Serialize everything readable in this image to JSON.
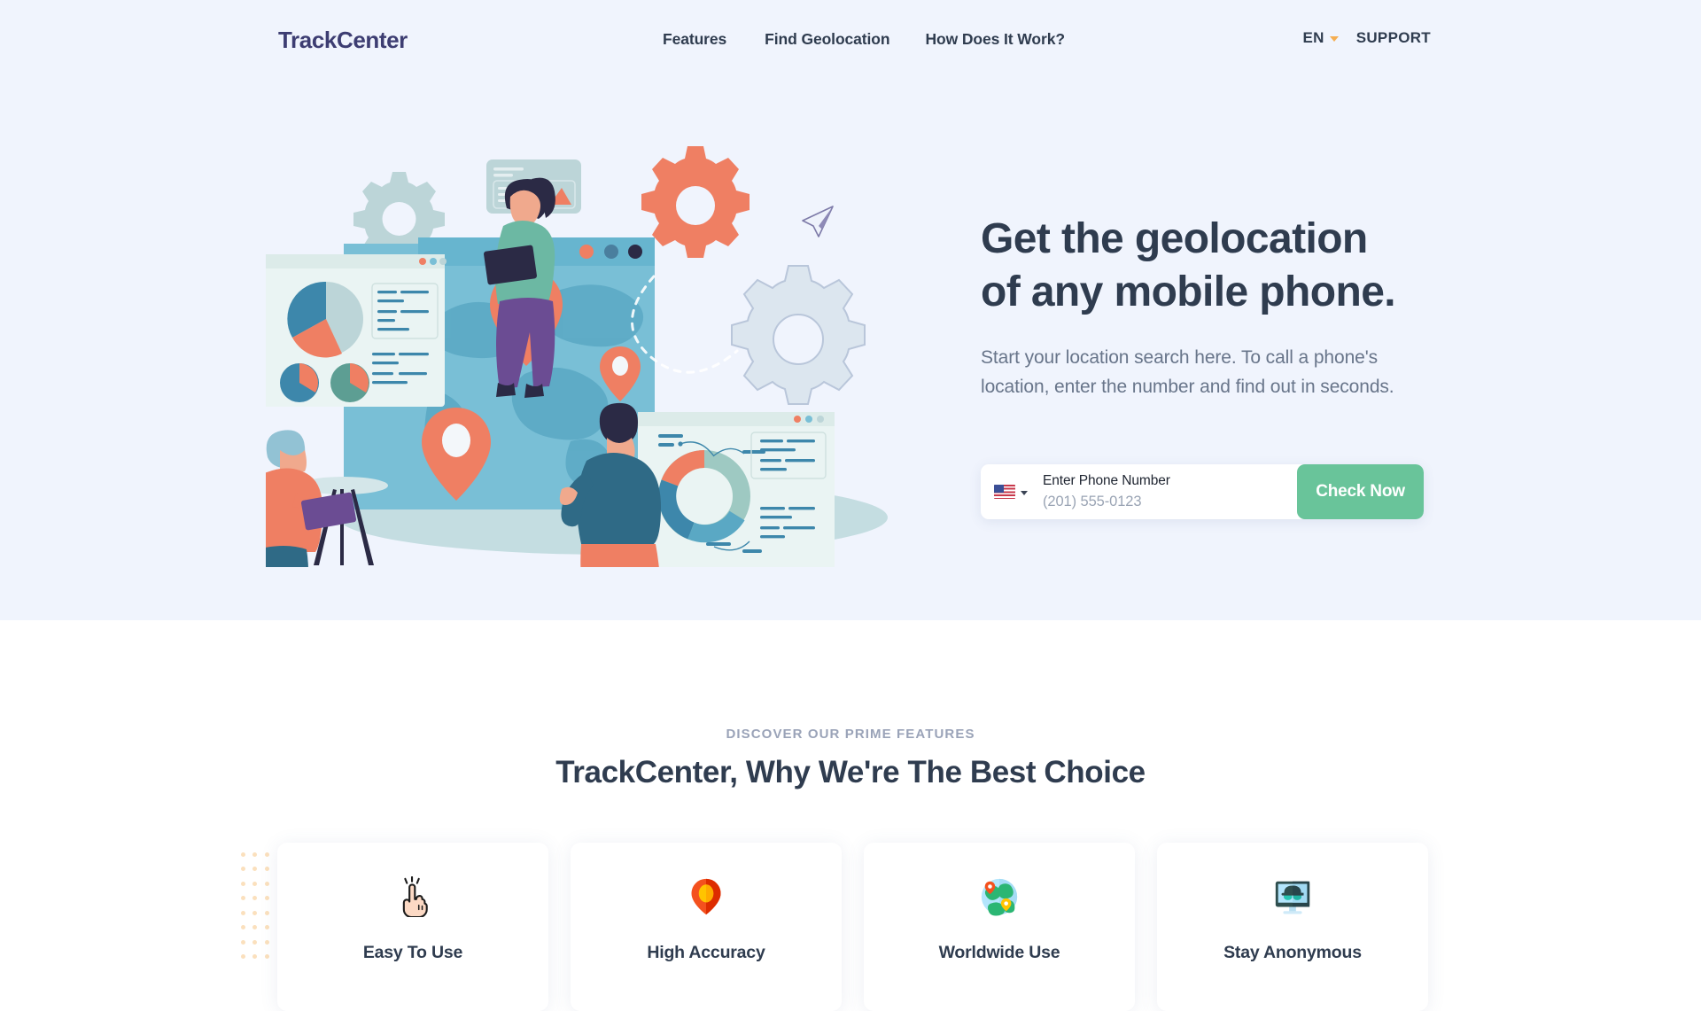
{
  "header": {
    "logo": "TrackCenter",
    "nav": [
      {
        "label": "Features"
      },
      {
        "label": "Find Geolocation"
      },
      {
        "label": "How Does It Work?"
      }
    ],
    "language": {
      "label": "EN",
      "caret_icon": "chevron-down-icon"
    },
    "support": "SUPPORT"
  },
  "hero": {
    "title_line1": "Get the geolocation",
    "title_line2": "of any mobile phone.",
    "subtitle": "Start your location search here. To call a phone's location, enter the number and find out in seconds.",
    "form": {
      "country_flag": "flag-us-icon",
      "country_caret": "chevron-down-icon",
      "phone_label": "Enter Phone Number",
      "phone_placeholder": "(201) 555-0123",
      "phone_value": "",
      "submit_label": "Check Now"
    },
    "illustration": "geolocation-team-illustration"
  },
  "features": {
    "eyebrow": "DISCOVER OUR PRIME FEATURES",
    "title": "TrackCenter, Why We're The Best Choice",
    "cards": [
      {
        "title": "Easy To Use",
        "icon": "pointing-hand-icon"
      },
      {
        "title": "High Accuracy",
        "icon": "map-pin-icon"
      },
      {
        "title": "Worldwide Use",
        "icon": "globe-pins-icon"
      },
      {
        "title": "Stay Anonymous",
        "icon": "monitor-spy-icon"
      }
    ]
  },
  "colors": {
    "hero_background": "#f0f4fd",
    "page_background": "#ffffff",
    "heading": "#2f3c4f",
    "body_text": "#68758a",
    "logo": "#3d3d72",
    "accent_green": "#69c49a",
    "accent_orange": "#f5ae52",
    "illustration_teal": "#4fa8c0",
    "illustration_coral": "#ef7f63"
  }
}
